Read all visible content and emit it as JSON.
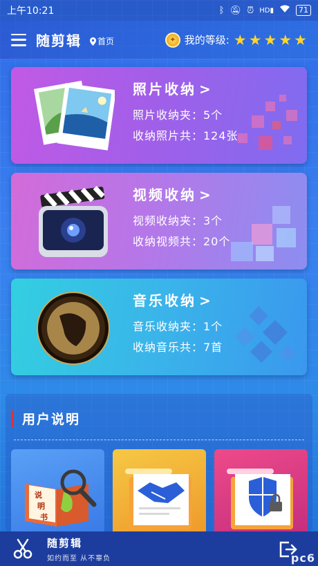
{
  "status_bar": {
    "time": "上午10:21",
    "battery": "71",
    "icons": [
      "bluetooth-icon",
      "mute-icon",
      "alarm-icon",
      "hd-signal-icon",
      "wifi-icon",
      "battery-icon"
    ]
  },
  "header": {
    "title": "随剪辑",
    "home_label": "首页",
    "level_label": "我的等级:",
    "stars": 5
  },
  "cards": [
    {
      "title": "照片收纳",
      "line1": "照片收纳夹：5个",
      "line2": "收纳照片共：124张"
    },
    {
      "title": "视频收纳",
      "line1": "视频收纳夹：3个",
      "line2": "收纳视频共：20个"
    },
    {
      "title": "音乐收纳",
      "line1": "音乐收纳夹：1个",
      "line2": "收纳音乐共：7首"
    }
  ],
  "user_guide": {
    "title": "用户说明",
    "book_label": "说明书"
  },
  "bottom_bar": {
    "title": "随剪辑",
    "subtitle": "如约而至 从不辜负"
  },
  "watermark": "pc6",
  "colors": {
    "accent_red": "#e83030",
    "star_yellow": "#ffd52e",
    "bottom_bar": "#1d3d9e"
  }
}
